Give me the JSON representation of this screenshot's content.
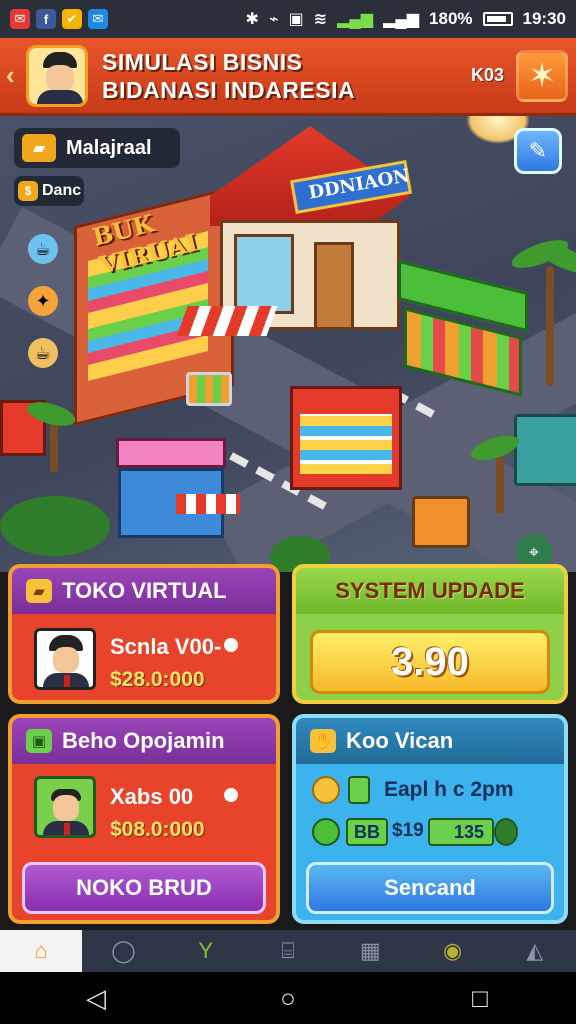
{
  "status_bar": {
    "apps": [
      {
        "glyph": "✉",
        "color": "#e53935"
      },
      {
        "glyph": "f",
        "color": "#3b5998"
      },
      {
        "glyph": "✔",
        "color": "#f5b400"
      },
      {
        "glyph": "✉",
        "color": "#1e88e5"
      }
    ],
    "battery": "180%",
    "time": "19:30"
  },
  "header": {
    "title_line1": "SIMULASI BISNIS",
    "title_line2": "BIDANASI INDARESIA",
    "code": "K03"
  },
  "scene": {
    "location_pill": "Malajraal",
    "coins_pill": "Danc",
    "shop_left_sign": "BUK VIRUAI",
    "shop_center_sign": "DDNIAON"
  },
  "cards": {
    "toko_virtual": {
      "title": "TOKO VIRTUAL",
      "person_name": "Scnla V00-",
      "money": "$28.0:000"
    },
    "system_update": {
      "title": "SYSTEM UPDADE",
      "value": "3.90"
    },
    "beho": {
      "title": "Beho Opojamin",
      "person_name": "Xabs 00",
      "money": "$08.0:000",
      "button": "NOKO BRUD"
    },
    "koo_vican": {
      "title": "Koo Vican",
      "subtitle": "Eapl h c 2pm",
      "stat_a": "BB",
      "stat_b": "$19",
      "stat_c": "135",
      "button": "Sencand"
    }
  },
  "colors": {
    "header": "#e9562a",
    "purple_head": "#8a3aa8",
    "red_card": "#e8432b",
    "green_head": "#7dc32b",
    "yellow_value": "#ffd93a",
    "blue_card": "#3cb3ec"
  },
  "icons": {
    "nav": [
      "home-icon",
      "search-icon",
      "plant-icon",
      "bank-icon",
      "calendar-icon",
      "location-icon",
      "alarm-icon"
    ]
  }
}
